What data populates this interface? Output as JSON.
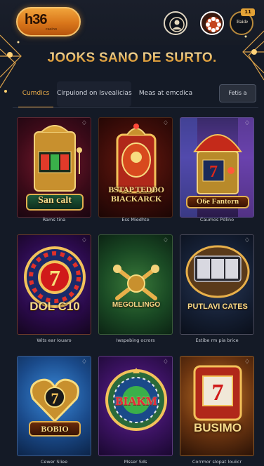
{
  "header": {
    "logo_text": "h36",
    "logo_sub": "casino",
    "badge": "11",
    "icon3_label": "Baide"
  },
  "page_title": "JOOKS SANO DE SURTO.",
  "tabs": [
    {
      "label": "Cumdics",
      "active": true
    },
    {
      "label": "Cirpuiond on Isvealicias",
      "active": false
    },
    {
      "label": "Meas at emcdica",
      "active": false
    }
  ],
  "filter_button": "Fetis a",
  "games": [
    {
      "title": "San calt",
      "caption": "Rams tina"
    },
    {
      "title": "BSTAP TEDDO BIACKARCK",
      "caption": "Ess Miedhte"
    },
    {
      "title": "O6e Fantorn",
      "caption": "Caumos Pdlino"
    },
    {
      "title": "DOL C10",
      "caption": "Wits ear Iouaro"
    },
    {
      "title": "MEGOLLINGO",
      "caption": "Iwspebing ocrors"
    },
    {
      "title": "PUTLAVI CATES",
      "caption": "Estibe rm pia brice"
    },
    {
      "title": "BOBIO",
      "caption": "Cewer Sliee"
    },
    {
      "title": "BIAKM",
      "caption": "Msser Sds"
    },
    {
      "title": "BUSIMO",
      "caption": "Corrmor slopat louiicr"
    }
  ],
  "colors": {
    "background": "#141a26",
    "accent": "#e8a03a",
    "gold": "#f5d98a"
  }
}
